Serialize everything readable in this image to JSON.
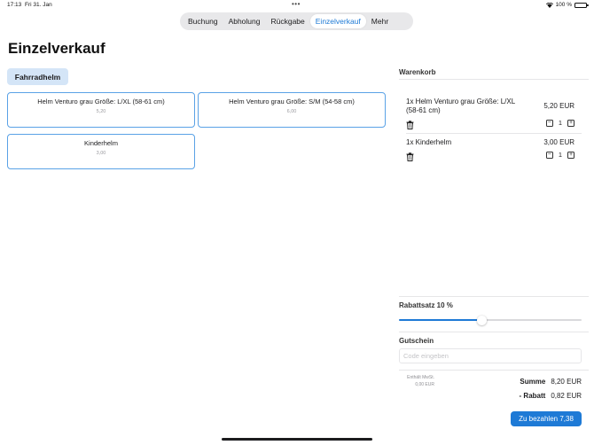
{
  "status_bar": {
    "time": "17:13",
    "date": "Fri 31. Jan",
    "battery": "100 %"
  },
  "tabs": [
    {
      "label": "Buchung",
      "active": false
    },
    {
      "label": "Abholung",
      "active": false
    },
    {
      "label": "Rückgabe",
      "active": false
    },
    {
      "label": "Einzelverkauf",
      "active": true
    },
    {
      "label": "Mehr",
      "active": false
    }
  ],
  "page": {
    "title": "Einzelverkauf",
    "category": "Fahrradhelm"
  },
  "products": [
    {
      "name": "Helm Venturo grau Größe: L/XL (58-61 cm)",
      "price": "5,20"
    },
    {
      "name": "Helm Venturo grau Größe: S/M (54-58 cm)",
      "price": "6,00"
    },
    {
      "name": "Kinderhelm",
      "price": "3,00"
    }
  ],
  "cart": {
    "title": "Warenkorb",
    "items": [
      {
        "name": "1x Helm Venturo grau Größe: L/XL (58-61 cm)",
        "price": "5,20 EUR",
        "qty": "1"
      },
      {
        "name": "1x Kinderhelm",
        "price": "3,00 EUR",
        "qty": "1"
      }
    ],
    "discount_label": "Rabattsatz 10 %",
    "discount_slider_fraction": 0.45,
    "voucher_label": "Gutschein",
    "voucher_placeholder": "Code eingeben",
    "vat_line1": "Enthält MwSt.",
    "vat_line2": "0,00 EUR",
    "sum_label": "Summe",
    "sum_value": "8,20 EUR",
    "discount_sum_label": "- Rabatt",
    "discount_sum_value": "0,82 EUR",
    "pay_button": "Zu bezahlen 7,38"
  },
  "colors": {
    "accent": "#1e7ad6",
    "chip_bg": "#d4e5f7",
    "card_border": "#5aa2e6"
  }
}
